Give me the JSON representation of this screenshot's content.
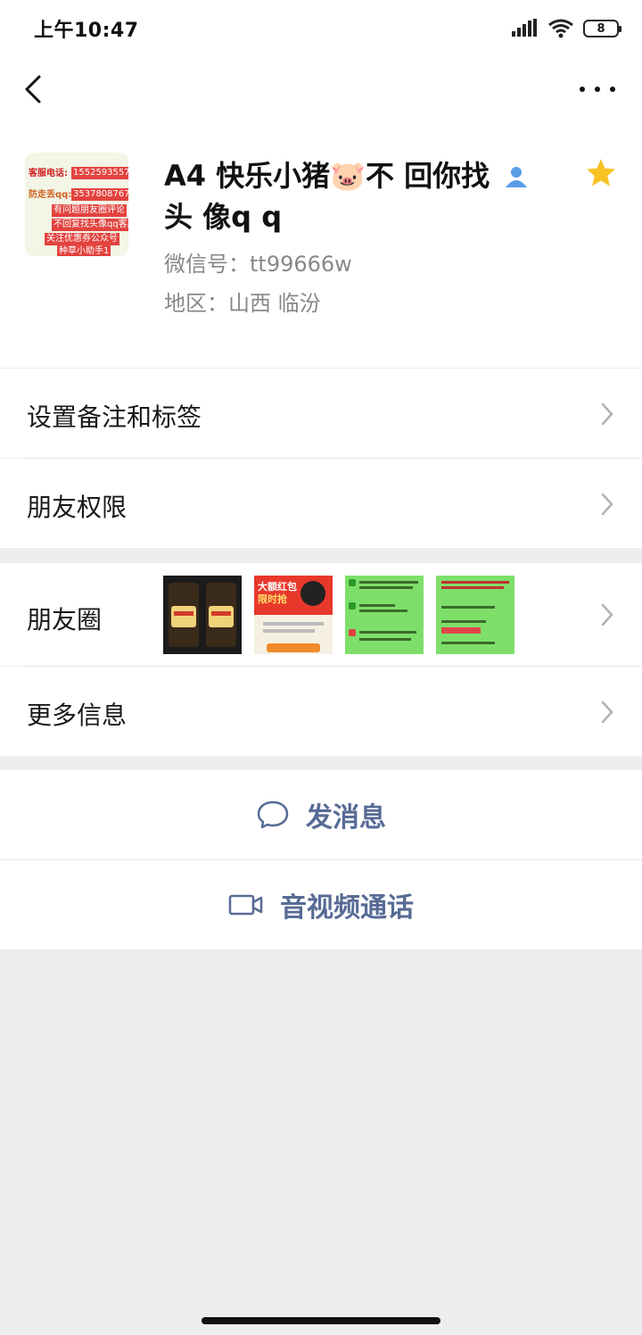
{
  "status_bar": {
    "time": "上午10:47",
    "battery": "8"
  },
  "profile": {
    "name": "A4 快乐小猪🐷不 回你找",
    "name_tail": "头 像q q",
    "wechat_id": "微信号：tt99666w",
    "region": "地区：山西  临汾",
    "avatar_text": {
      "line1_label": "客服电话:",
      "line1_value": "15525935571",
      "line2_label": "防走丢qq:",
      "line2_value": "3537808767",
      "line3": "有问题朋友圈评论",
      "line4": "不回复找头像qq客服",
      "line5": "关注优惠券公众号",
      "line6": "种草小助手1"
    }
  },
  "cells": {
    "remark": "设置备注和标签",
    "permissions": "朋友权限",
    "moments": "朋友圈",
    "more_info": "更多信息"
  },
  "moments_thumbs": {
    "t2_title": "大额红包",
    "t2_sub": "限时抢"
  },
  "actions": {
    "message": "发消息",
    "video_call": "音视频通话"
  },
  "colors": {
    "link_blue": "#576b95",
    "star": "#f7c326",
    "background": "#ededed"
  }
}
